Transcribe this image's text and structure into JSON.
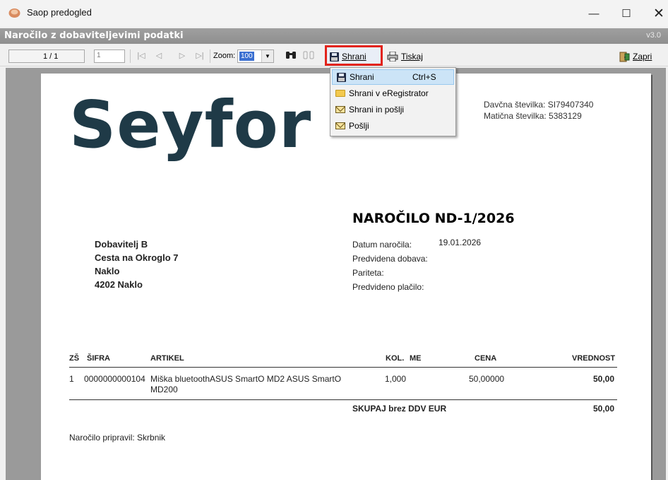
{
  "window": {
    "title": "Saop predogled",
    "minimize_glyph": "—",
    "maximize_glyph": "☐",
    "close_glyph": "✕"
  },
  "header": {
    "title": "Naročilo z dobaviteljevimi podatki",
    "version": "v3.0"
  },
  "toolbar": {
    "page_indicator": "1 / 1",
    "page_input_value": "1",
    "zoom_label": "Zoom:",
    "zoom_value": "100",
    "save_label": "Shrani",
    "print_label": "Tiskaj",
    "close_label": "Zapri"
  },
  "save_menu": {
    "items": [
      {
        "label": "Shrani",
        "shortcut": "Ctrl+S",
        "icon": "floppy-icon",
        "selected": true
      },
      {
        "label": "Shrani v eRegistrator",
        "shortcut": "",
        "icon": "folder-icon",
        "selected": false
      },
      {
        "label": "Shrani in pošlji",
        "shortcut": "",
        "icon": "envelope-icon",
        "selected": false
      },
      {
        "label": "Pošlji",
        "shortcut": "",
        "icon": "envelope-icon",
        "selected": false
      }
    ]
  },
  "document": {
    "logo_text": "Seyfor",
    "tax_number": "Davčna številka: SI79407340",
    "registration_number": "Matična številka: 5383129",
    "title": "NAROČILO ND-1/2026",
    "meta_labels": [
      "Datum naročila:",
      "Predvidena dobava:",
      "Pariteta:",
      "Predvideno plačilo:"
    ],
    "order_date": "19.01.2026",
    "supplier": [
      "Dobavitelj B",
      "Cesta na Okroglo 7",
      "Naklo",
      "4202 Naklo"
    ],
    "table": {
      "headers": {
        "zs": "ZŠ",
        "sifra": "ŠIFRA",
        "artikel": "ARTIKEL",
        "kol": "KOL.",
        "me": "ME",
        "cena": "CENA",
        "vrednost": "VREDNOST"
      },
      "rows": [
        {
          "zs": "1",
          "sifra": "0000000000104",
          "artikel_line1": "Miška bluetoothASUS SmartO MD2 ASUS SmartO",
          "artikel_line2": "MD200",
          "kol": "1,000",
          "me": "",
          "cena": "50,00000",
          "vrednost": "50,00"
        }
      ],
      "total_label": "SKUPAJ brez DDV EUR",
      "total_value": "50,00"
    },
    "prepared_by": "Naročilo pripravil: Skrbnik"
  },
  "colors": {
    "logo": "#1f3a47",
    "highlight_border": "#e2231a",
    "menu_selected": "#cce4f7"
  }
}
